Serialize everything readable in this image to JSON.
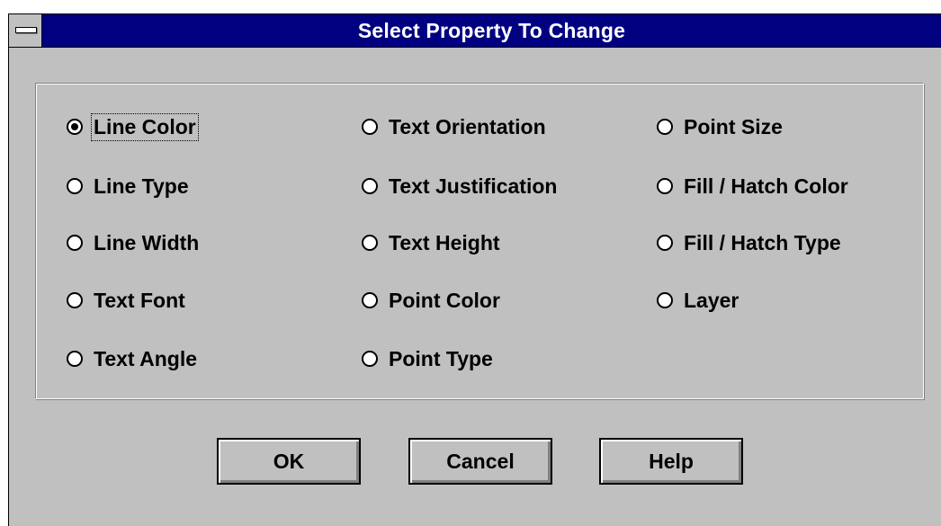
{
  "window": {
    "title": "Select Property To Change"
  },
  "options": {
    "col1": [
      {
        "label": "Line Color",
        "checked": true
      },
      {
        "label": "Line Type",
        "checked": false
      },
      {
        "label": "Line Width",
        "checked": false
      },
      {
        "label": "Text Font",
        "checked": false
      },
      {
        "label": "Text Angle",
        "checked": false
      }
    ],
    "col2": [
      {
        "label": "Text Orientation",
        "checked": false
      },
      {
        "label": "Text Justification",
        "checked": false
      },
      {
        "label": "Text Height",
        "checked": false
      },
      {
        "label": "Point Color",
        "checked": false
      },
      {
        "label": "Point Type",
        "checked": false
      }
    ],
    "col3": [
      {
        "label": "Point Size",
        "checked": false
      },
      {
        "label": "Fill / Hatch Color",
        "checked": false
      },
      {
        "label": "Fill / Hatch Type",
        "checked": false
      },
      {
        "label": "Layer",
        "checked": false
      }
    ]
  },
  "buttons": {
    "ok": "OK",
    "cancel": "Cancel",
    "help": "Help"
  },
  "colors": {
    "titlebar": "#000080",
    "face": "#c0c0c0"
  }
}
